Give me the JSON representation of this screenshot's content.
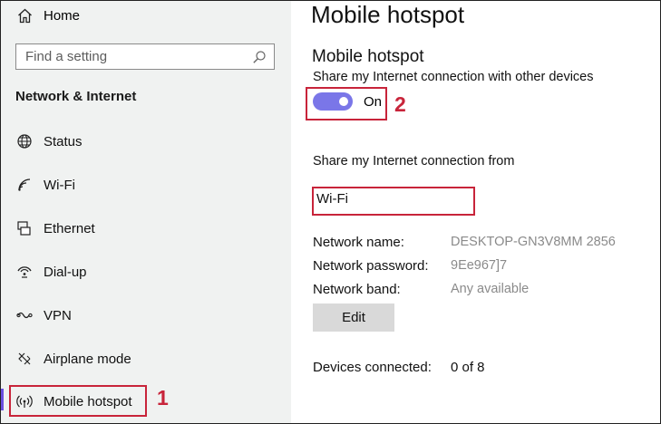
{
  "sidebar": {
    "home_label": "Home",
    "search_placeholder": "Find a setting",
    "section_title": "Network & Internet",
    "items": [
      {
        "label": "Status",
        "icon": "status-globe-icon"
      },
      {
        "label": "Wi-Fi",
        "icon": "wifi-icon"
      },
      {
        "label": "Ethernet",
        "icon": "ethernet-icon"
      },
      {
        "label": "Dial-up",
        "icon": "dial-up-icon"
      },
      {
        "label": "VPN",
        "icon": "vpn-icon"
      },
      {
        "label": "Airplane mode",
        "icon": "airplane-icon"
      },
      {
        "label": "Mobile hotspot",
        "icon": "hotspot-icon"
      }
    ]
  },
  "main": {
    "page_title": "Mobile hotspot",
    "section_title": "Mobile hotspot",
    "share_desc": "Share my Internet connection with other devices",
    "toggle_state": "On",
    "share_from_label": "Share my Internet connection from",
    "share_from_value": "Wi-Fi",
    "network_name_label": "Network name:",
    "network_name_value": "DESKTOP-GN3V8MM 2856",
    "network_password_label": "Network password:",
    "network_password_value": "9Ee967]7",
    "network_band_label": "Network band:",
    "network_band_value": "Any available",
    "edit_label": "Edit",
    "devices_label": "Devices connected:",
    "devices_value": "0 of 8"
  },
  "annotations": {
    "callout_1": "1",
    "callout_2": "2"
  },
  "colors": {
    "accent": "#7a76e8",
    "highlight": "#c8243a",
    "active_indicator": "#6b4fe0"
  }
}
